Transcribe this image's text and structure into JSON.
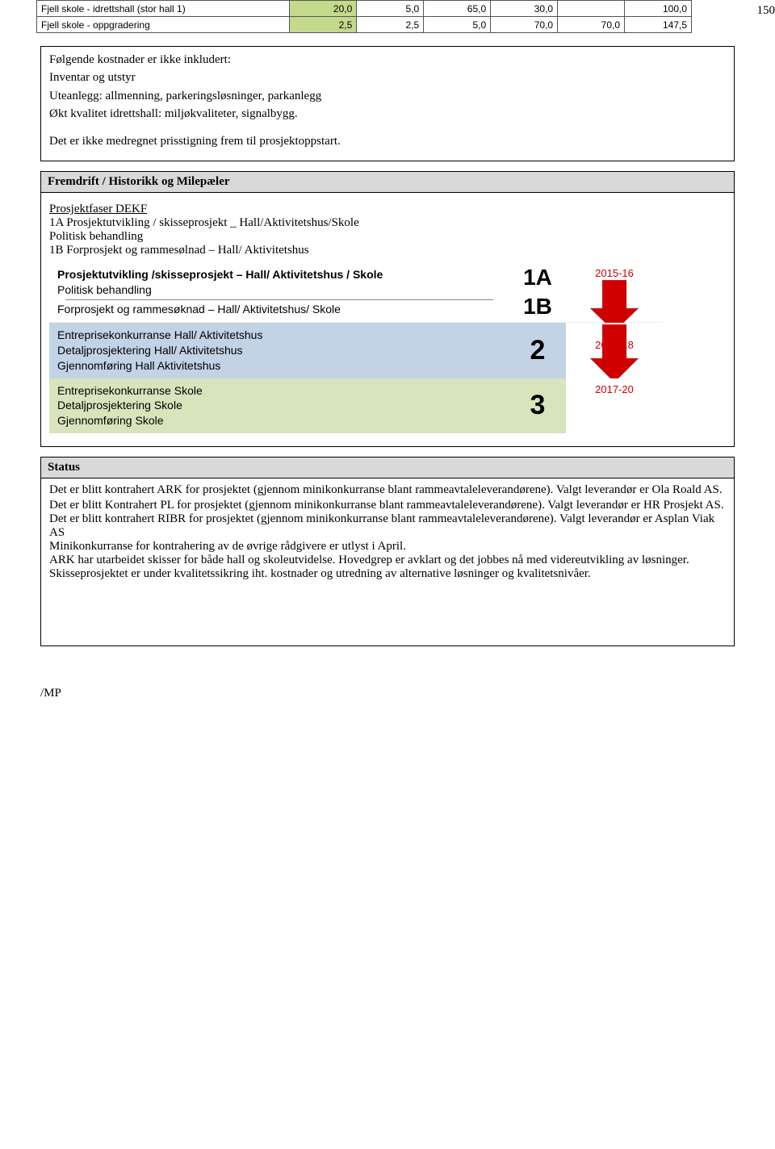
{
  "page_number": "150",
  "top_table": {
    "rows": [
      {
        "label": "Fjell skole - idrettshall (stor hall 1)",
        "cells": [
          "20,0",
          "5,0",
          "65,0",
          "30,0",
          "",
          "100,0"
        ]
      },
      {
        "label": "Fjell skole - oppgradering",
        "cells": [
          "2,5",
          "2,5",
          "5,0",
          "70,0",
          "70,0",
          "147,5"
        ]
      }
    ]
  },
  "box1": {
    "line1": "Følgende kostnader er ikke inkludert:",
    "line2": "Inventar og utstyr",
    "line3": "Uteanlegg: allmenning, parkeringsløsninger, parkanlegg",
    "line4": "Økt kvalitet idrettshall: miljøkvaliteter, signalbygg.",
    "line5": "Det er ikke medregnet prisstigning frem til prosjektoppstart."
  },
  "box2": {
    "header": "Fremdrift / Historikk og Milepæler",
    "subheading": "Prosjektfaser DEKF",
    "line1": "1A Prosjektutvikling / skisseprosjekt _ Hall/Aktivitetshus/Skole",
    "line2": "Politisk behandling",
    "line3": "1B Forprosjekt og rammesølnad – Hall/ Aktivitetshus",
    "phase1A": {
      "num": "1A",
      "l1": "Prosjektutvikling /skisseprosjekt – Hall/ Aktivitetshus / Skole",
      "l2": "Politisk behandling"
    },
    "phase1B": {
      "num": "1B",
      "l1": "Forprosjekt og rammesøknad – Hall/ Aktivitetshus/ Skole"
    },
    "phase2": {
      "num": "2",
      "l1": "Entreprisekonkurranse Hall/ Aktivitetshus",
      "l2": "Detaljprosjektering Hall/ Aktivitetshus",
      "l3": "Gjennomføring Hall Aktivitetshus"
    },
    "phase3": {
      "num": "3",
      "l1": "Entreprisekonkurranse Skole",
      "l2": "Detaljprosjektering Skole",
      "l3": "Gjennomføring Skole"
    },
    "years": {
      "a": "2015-16",
      "b": "2016-18",
      "c": "2017-20"
    }
  },
  "status": {
    "header": "Status",
    "p1": "Det er blitt kontrahert ARK for prosjektet (gjennom minikonkurranse blant rammeavtaleleverandørene). Valgt leverandør er Ola Roald AS.",
    "p2": "Det er blitt Kontrahert PL for prosjektet (gjennom minikonkurranse blant rammeavtaleleverandørene). Valgt leverandør er HR Prosjekt AS.",
    "p3": "Det er blitt kontrahert RIBR for prosjektet (gjennom minikonkurranse blant rammeavtaleleverandørene). Valgt leverandør er Asplan Viak AS",
    "p4": "Minikonkurranse for kontrahering av de øvrige rådgivere er utlyst i April.",
    "p5a": "ARK har utarbeidet skisser for både hall og skoleutvidelse. Hovedgrep er avklart og det jobbes nå med videreutvikling av løsninger.",
    "p5b": "Skisseprosjektet er under kvalitetssikring iht. kostnader og utredning av alternative løsninger og kvalitetsnivåer."
  },
  "footer": "/MP"
}
